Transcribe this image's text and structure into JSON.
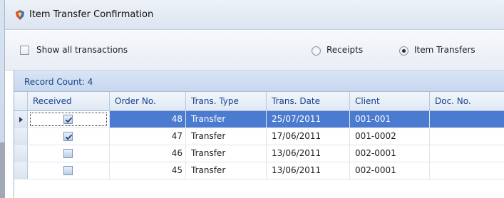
{
  "window": {
    "title": "Item Transfer Confirmation"
  },
  "options": {
    "show_all_label": "Show all transactions",
    "show_all_checked": false,
    "receipts_label": "Receipts",
    "item_transfers_label": "Item Transfers",
    "selected_mode": "Item Transfers"
  },
  "grid": {
    "record_count": "Record Count: 4",
    "columns": [
      "Received",
      "Order No.",
      "Trans. Type",
      "Trans. Date",
      "Client",
      "Doc. No."
    ],
    "rows": [
      {
        "received": true,
        "order_no": "48",
        "trans_type": "Transfer",
        "trans_date": "25/07/2011",
        "client": "001-001",
        "doc_no": ""
      },
      {
        "received": true,
        "order_no": "47",
        "trans_type": "Transfer",
        "trans_date": "17/06/2011",
        "client": "001-0002",
        "doc_no": ""
      },
      {
        "received": false,
        "order_no": "46",
        "trans_type": "Transfer",
        "trans_date": "13/06/2011",
        "client": "002-0001",
        "doc_no": ""
      },
      {
        "received": false,
        "order_no": "45",
        "trans_type": "Transfer",
        "trans_date": "13/06/2011",
        "client": "002-0001",
        "doc_no": ""
      }
    ],
    "selected_row": 0
  },
  "colors": {
    "selection": "#4a7bd0",
    "header_text": "#15428b"
  },
  "icons": {
    "title": "app-shield-icon",
    "row_indicator": "current-row-arrow-icon",
    "check": "checkmark-icon"
  }
}
